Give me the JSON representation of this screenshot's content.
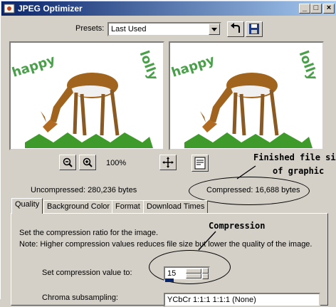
{
  "window": {
    "title": "JPEG Optimizer",
    "min_glyph": "_",
    "max_glyph": "□",
    "close_glyph": "×"
  },
  "presets": {
    "label": "Presets:",
    "value": "Last Used"
  },
  "preview": {
    "watermark_left": "happy",
    "watermark_right": "lolly"
  },
  "zoom": {
    "level": "100%"
  },
  "sizes": {
    "uncompressed": "Uncompressed:  280,236 bytes",
    "compressed": "Compressed: 16,688 bytes"
  },
  "annotations": {
    "finished_line1": "Finished file size",
    "finished_line2": "of graphic",
    "compression": "Compression"
  },
  "tabs": [
    "Quality",
    "Background Color",
    "Format",
    "Download Times"
  ],
  "quality": {
    "line1": "Set the compression ratio for the image.",
    "line2": "Note:  Higher compression values reduces file size but lower the quality of the image.",
    "set_label": "Set compression value to:",
    "value": "15",
    "chroma_label": "Chroma subsampling:",
    "chroma_value": "YCbCr 1:1:1 1:1:1 (None)"
  },
  "colors": {
    "title_start": "#0a246a",
    "title_end": "#a6caf0",
    "face": "#d4d0c8",
    "progress": "#0a246a",
    "watermark": "#4aa04a"
  }
}
